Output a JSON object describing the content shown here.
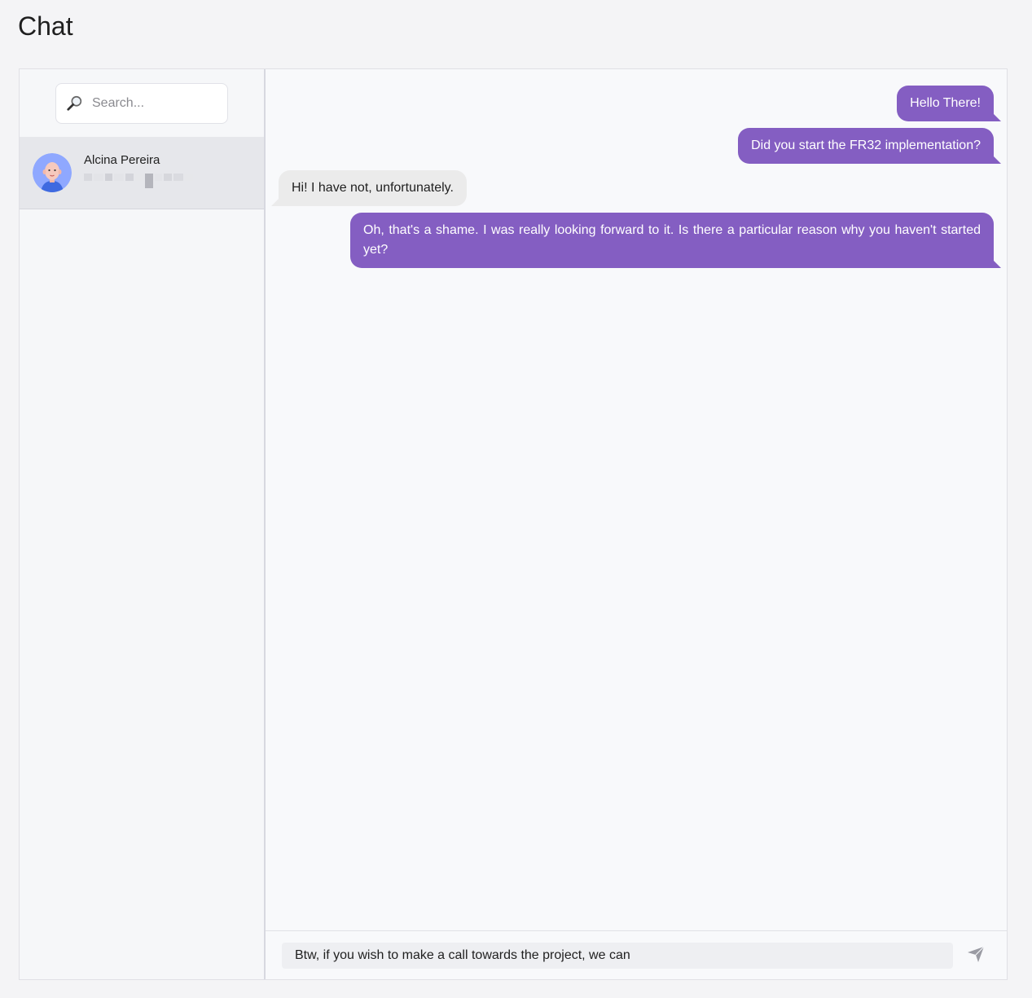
{
  "page": {
    "title": "Chat"
  },
  "sidebar": {
    "search": {
      "placeholder": "Search...",
      "value": "",
      "icon": "magnifier-icon"
    },
    "contacts": [
      {
        "name": "Alcina Pereira",
        "avatar_icon": "person-avatar",
        "preview_obscured": true
      }
    ]
  },
  "conversation": {
    "messages": [
      {
        "direction": "outgoing",
        "text": "Hello There!"
      },
      {
        "direction": "outgoing",
        "text": "Did you start the FR32 implementation?"
      },
      {
        "direction": "incoming",
        "text": "Hi! I have not, unfortunately."
      },
      {
        "direction": "outgoing",
        "text": "Oh, that's a shame. I was really looking forward to it. Is there a particular reason why you haven't started yet?"
      }
    ]
  },
  "composer": {
    "value": "Btw, if you wish to make a call towards the project, we can",
    "send_icon": "send-icon"
  },
  "colors": {
    "outgoing_bubble": "#845ec2",
    "incoming_bubble": "#ebebeb",
    "selected_contact": "#e6e7eb"
  }
}
